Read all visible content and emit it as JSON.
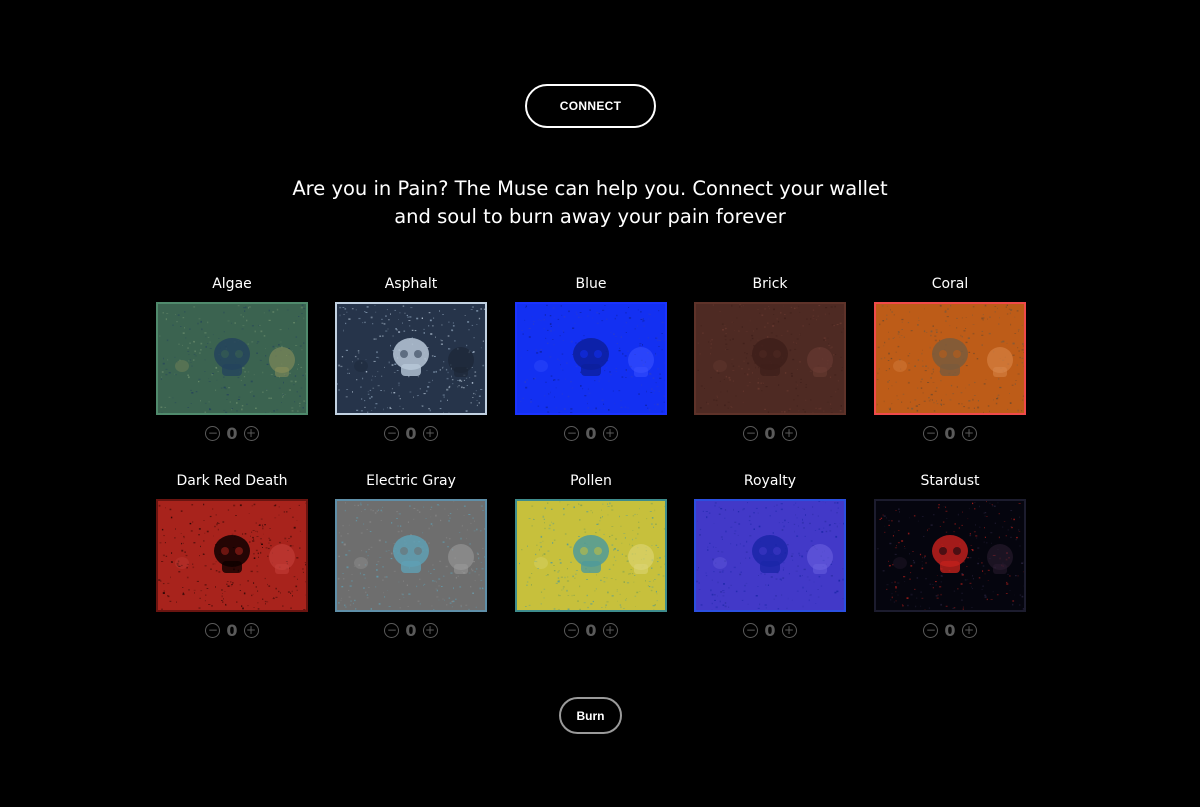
{
  "header": {
    "connect_label": "CONNECT"
  },
  "intro": {
    "text": "Are you in Pain? The Muse can help you. Connect your wallet and soul to burn away your pain forever"
  },
  "stepper": {
    "minus_symbol": "−",
    "plus_symbol": "+"
  },
  "variants": [
    {
      "name": "Algae",
      "quantity": "0",
      "bg": "#3b6350",
      "border": "#4f8a6c",
      "skull": "#24435c",
      "skull2": "#8a8f5a",
      "noise": "#6d8f6d"
    },
    {
      "name": "Asphalt",
      "quantity": "0",
      "bg": "#26344a",
      "border": "#c2d2e2",
      "skull": "#b8c8d8",
      "skull2": "#1b2433",
      "noise": "#8fa5bd"
    },
    {
      "name": "Blue",
      "quantity": "0",
      "bg": "#1330f2",
      "border": "#1a33ff",
      "skull": "#0d1f9c",
      "skull2": "#3a52ff",
      "noise": "#2a3bd0"
    },
    {
      "name": "Brick",
      "quantity": "0",
      "bg": "#4e2a23",
      "border": "#5e3229",
      "skull": "#3e1f1a",
      "skull2": "#6a3c33",
      "noise": "#6a3a30"
    },
    {
      "name": "Coral",
      "quantity": "0",
      "bg": "#bd5c18",
      "border": "#f04a4a",
      "skull": "#7a5a3c",
      "skull2": "#d9864a",
      "noise": "#6f4a2c"
    },
    {
      "name": "Dark Red Death",
      "quantity": "0",
      "bg": "#a8231c",
      "border": "#6a1410",
      "skull": "#0e0000",
      "skull2": "#c4403a",
      "noise": "#4a0c08"
    },
    {
      "name": "Electric Gray",
      "quantity": "0",
      "bg": "#6e6e6e",
      "border": "#5f8fa8",
      "skull": "#5fa0b4",
      "skull2": "#9a9a9a",
      "noise": "#8a8a8a"
    },
    {
      "name": "Pollen",
      "quantity": "0",
      "bg": "#c7c03c",
      "border": "#3e8c8c",
      "skull": "#4f9a9a",
      "skull2": "#ddd676",
      "noise": "#7fa050"
    },
    {
      "name": "Royalty",
      "quantity": "0",
      "bg": "#4239c8",
      "border": "#2b4fe0",
      "skull": "#1a26a8",
      "skull2": "#6a60e0",
      "noise": "#2c2ea8"
    },
    {
      "name": "Stardust",
      "quantity": "0",
      "bg": "#05050e",
      "border": "#1c1c2e",
      "skull": "#c0201c",
      "skull2": "#2a1c30",
      "noise": "#2a2440"
    }
  ],
  "footer": {
    "burn_label": "Burn"
  }
}
